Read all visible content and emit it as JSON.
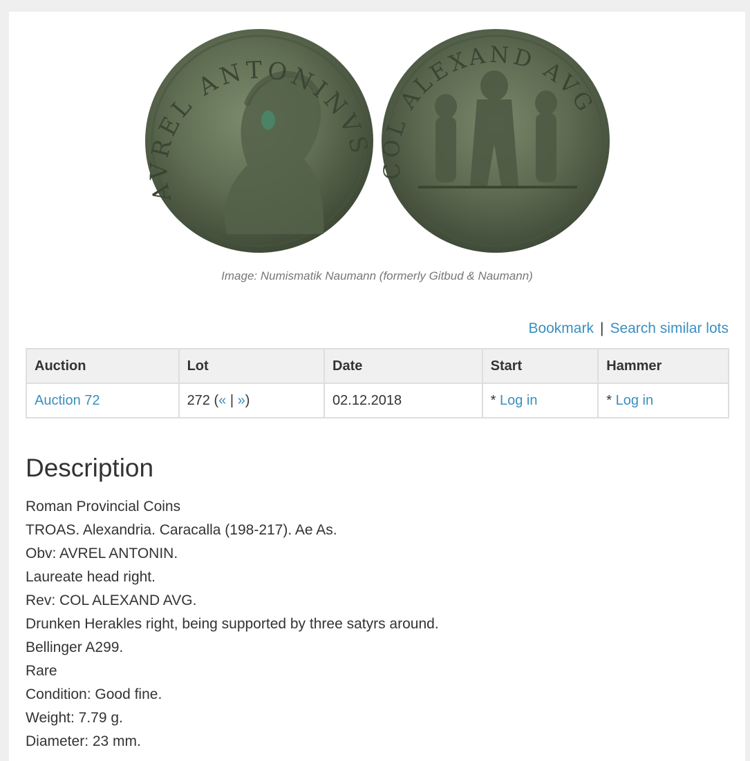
{
  "image": {
    "caption": "Image: Numismatik Naumann (formerly Gitbud & Naumann)",
    "obverse_legend": "AVREL ANTONINVS",
    "reverse_legend": "COL ALEXAND AVG"
  },
  "actions": {
    "bookmark": "Bookmark",
    "separator": "|",
    "search_similar": "Search similar lots"
  },
  "table": {
    "headers": {
      "auction": "Auction",
      "lot": "Lot",
      "date": "Date",
      "start": "Start",
      "hammer": "Hammer"
    },
    "row": {
      "auction": "Auction 72",
      "lot_number": "272",
      "lot_open": "(",
      "prev": "«",
      "lot_sep": "|",
      "next": "»",
      "lot_close": ")",
      "date": "02.12.2018",
      "start_prefix": "* ",
      "start_login": "Log in",
      "hammer_prefix": "* ",
      "hammer_login": "Log in"
    }
  },
  "description": {
    "title": "Description",
    "lines": [
      "Roman Provincial Coins",
      "TROAS. Alexandria. Caracalla (198-217). Ae As.",
      "Obv: AVREL ANTONIN.",
      "Laureate head right.",
      "Rev: COL ALEXAND AVG.",
      "Drunken Herakles right, being supported by three satyrs around.",
      "Bellinger A299.",
      "Rare",
      "Condition: Good fine.",
      "Weight: 7.79 g.",
      "Diameter: 23 mm."
    ]
  },
  "colors": {
    "link": "#3a8fc0",
    "text": "#333333",
    "header_bg": "#f0f0f0",
    "coin_bronze": "#5c6a4f"
  }
}
